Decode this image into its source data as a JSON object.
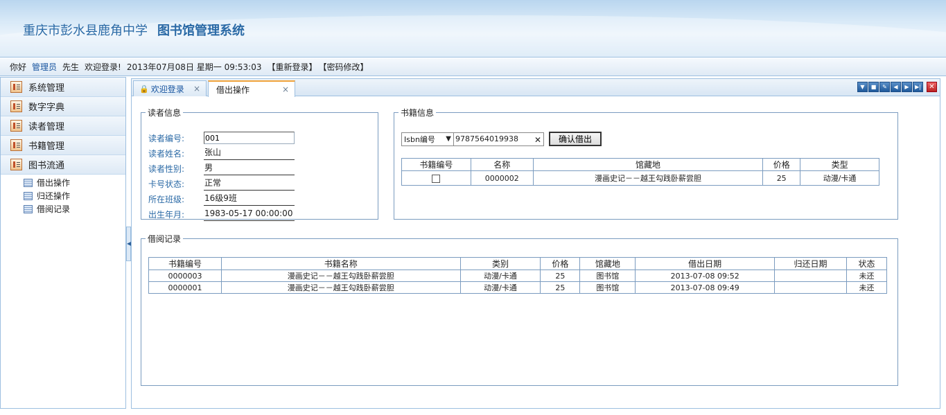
{
  "banner": {
    "school": "重庆市彭水县鹿角中学",
    "system": "图书馆管理系统"
  },
  "infobar": {
    "greeting": "你好",
    "user": "管理员",
    "honorific": "先生",
    "welcome": "欢迎登录!",
    "datetime": "2013年07月08日 星期一 09:53:03",
    "relogin": "【重新登录】",
    "change_password": "【密码修改】"
  },
  "sidebar": {
    "items": [
      {
        "label": "系统管理"
      },
      {
        "label": "数字字典"
      },
      {
        "label": "读者管理"
      },
      {
        "label": "书籍管理"
      },
      {
        "label": "图书流通"
      }
    ],
    "sub_items": [
      {
        "label": "借出操作"
      },
      {
        "label": "归还操作"
      },
      {
        "label": "借阅记录"
      }
    ]
  },
  "tabs": [
    {
      "label": "欢迎登录",
      "close": "×"
    },
    {
      "label": "借出操作",
      "close": "×"
    }
  ],
  "reader": {
    "legend": "读者信息",
    "fields": [
      {
        "label": "读者编号:",
        "value": "001"
      },
      {
        "label": "读者姓名:",
        "value": "张山"
      },
      {
        "label": "读者性别:",
        "value": "男"
      },
      {
        "label": "卡号状态:",
        "value": "正常"
      },
      {
        "label": "所在班级:",
        "value": "16级9班"
      },
      {
        "label": "出生年月:",
        "value": "1983-05-17 00:00:00"
      }
    ]
  },
  "book": {
    "legend": "书籍信息",
    "select_value": "Isbn编号",
    "isbn_value": "9787564019938",
    "confirm_label": "确认借出",
    "headers": [
      "书籍编号",
      "名称",
      "馆藏地",
      "价格",
      "类型"
    ],
    "rows": [
      {
        "name": "0000002",
        "location": "漫画史记－－越王勾践卧薪尝胆",
        "price": "25",
        "type": "动漫/卡通"
      }
    ]
  },
  "records": {
    "legend": "借阅记录",
    "headers": [
      "书籍编号",
      "书籍名称",
      "类别",
      "价格",
      "馆藏地",
      "借出日期",
      "归还日期",
      "状态"
    ],
    "rows": [
      [
        "0000003",
        "漫画史记－－越王勾践卧薪尝胆",
        "动漫/卡通",
        "25",
        "图书馆",
        "2013-07-08 09:52",
        "",
        "未还"
      ],
      [
        "0000001",
        "漫画史记－－越王勾践卧薪尝胆",
        "动漫/卡通",
        "25",
        "图书馆",
        "2013-07-08 09:49",
        "",
        "未还"
      ]
    ]
  },
  "colors": {
    "title_blue": "#2b6aa6",
    "border_blue": "#9dbfe0",
    "tab_accent": "#f0a23a"
  }
}
